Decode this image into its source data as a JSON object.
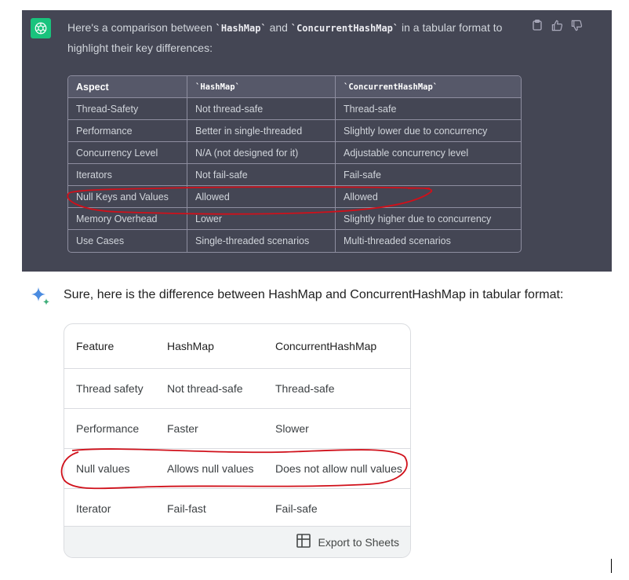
{
  "chatgpt": {
    "intro_a": "Here's a comparison between ",
    "intro_code1": "`HashMap`",
    "intro_b": " and ",
    "intro_code2": "`ConcurrentHashMap`",
    "intro_c": " in a tabular format to highlight their key differences:",
    "avatar_icon": "openai-logo-icon",
    "actions": [
      "copy-icon",
      "thumbs-up-icon",
      "thumbs-down-icon"
    ],
    "table": {
      "headers": [
        "Aspect",
        "`HashMap`",
        "`ConcurrentHashMap`"
      ],
      "rows": [
        [
          "Thread-Safety",
          "Not thread-safe",
          "Thread-safe"
        ],
        [
          "Performance",
          "Better in single-threaded",
          "Slightly lower due to concurrency"
        ],
        [
          "Concurrency Level",
          "N/A (not designed for it)",
          "Adjustable concurrency level"
        ],
        [
          "Iterators",
          "Not fail-safe",
          "Fail-safe"
        ],
        [
          "Null Keys and Values",
          "Allowed",
          "Allowed"
        ],
        [
          "Memory Overhead",
          "Lower",
          "Slightly higher due to concurrency"
        ],
        [
          "Use Cases",
          "Single-threaded scenarios",
          "Multi-threaded scenarios"
        ]
      ]
    },
    "colors": {
      "panel": "#444654",
      "avatar": "#19c37d",
      "annotation": "#d0101a"
    }
  },
  "bard": {
    "icon": "bard-sparkle-icon",
    "intro": "Sure, here is the difference between HashMap and ConcurrentHashMap in tabular format:",
    "table": {
      "headers": [
        "Feature",
        "HashMap",
        "ConcurrentHashMap"
      ],
      "rows": [
        [
          "Thread safety",
          "Not thread-safe",
          "Thread-safe"
        ],
        [
          "Performance",
          "Faster",
          "Slower"
        ],
        [
          "Null values",
          "Allows null values",
          "Does not allow null values"
        ],
        [
          "Iterator",
          "Fail-fast",
          "Fail-safe"
        ]
      ]
    },
    "export_label": "Export to Sheets",
    "export_icon": "sheets-table-icon"
  }
}
